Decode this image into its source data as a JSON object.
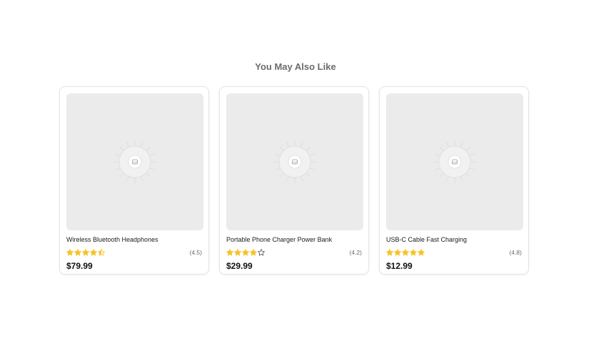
{
  "section": {
    "title": "You May Also Like"
  },
  "colors": {
    "star_fill": "#f7c325",
    "star_empty_stroke": "#555555",
    "placeholder_bg": "#ebebeb"
  },
  "icons": {
    "image_placeholder": "image-placeholder-icon",
    "star": "star-icon"
  },
  "products": [
    {
      "name": "Wireless Bluetooth Headphones",
      "rating": 4.5,
      "rating_label": "(4.5)",
      "price": "$79.99"
    },
    {
      "name": "Portable Phone Charger Power Bank",
      "rating": 4.2,
      "rating_label": "(4.2)",
      "price": "$29.99"
    },
    {
      "name": "USB-C Cable Fast Charging",
      "rating": 4.8,
      "rating_label": "(4.8)",
      "price": "$12.99"
    }
  ]
}
